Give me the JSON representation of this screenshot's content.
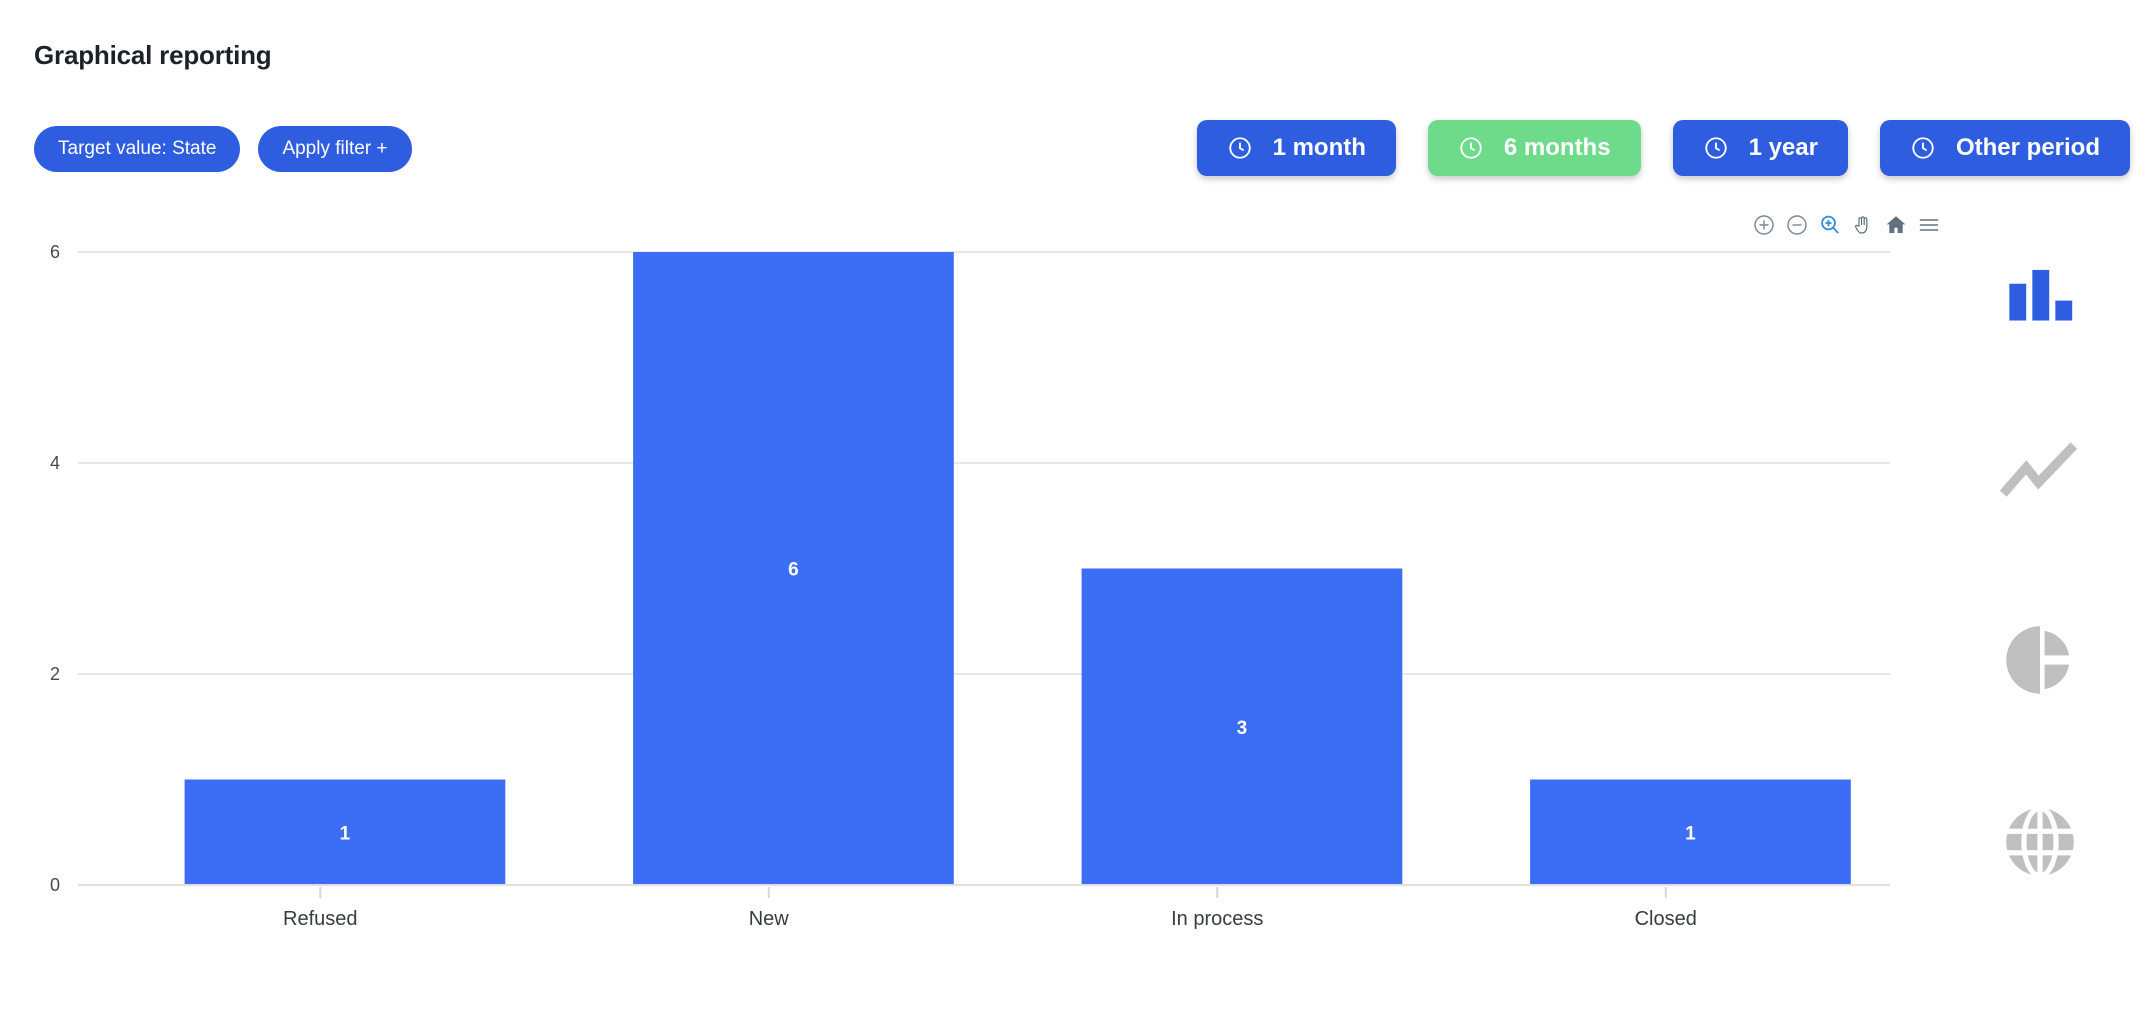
{
  "header": {
    "title": "Graphical reporting"
  },
  "filters": [
    {
      "label": "Target value: State",
      "name": "target-value-filter"
    },
    {
      "label": "Apply filter +",
      "name": "apply-filter-button"
    }
  ],
  "periods": [
    {
      "label": "1 month",
      "name": "period-1-month",
      "active": false,
      "icon": "clock-icon"
    },
    {
      "label": "6 months",
      "name": "period-6-months",
      "active": true,
      "icon": "clock-icon"
    },
    {
      "label": "1 year",
      "name": "period-1-year",
      "active": false,
      "icon": "clock-icon"
    },
    {
      "label": "Other period",
      "name": "period-other",
      "active": false,
      "icon": "clock-icon"
    }
  ],
  "chart_toolbar": [
    {
      "name": "zoom-in-icon",
      "title": "Zoom In"
    },
    {
      "name": "zoom-out-icon",
      "title": "Zoom Out"
    },
    {
      "name": "selection-zoom-icon",
      "title": "Selection Zoom",
      "active": true
    },
    {
      "name": "panning-icon",
      "title": "Panning"
    },
    {
      "name": "reset-home-icon",
      "title": "Reset Zoom"
    },
    {
      "name": "menu-icon",
      "title": "Menu"
    }
  ],
  "chart_type_rail": [
    {
      "name": "bar-chart-icon",
      "label": "Bar chart",
      "active": true
    },
    {
      "name": "line-chart-icon",
      "label": "Line chart",
      "active": false
    },
    {
      "name": "pie-chart-icon",
      "label": "Pie chart",
      "active": false
    },
    {
      "name": "globe-map-icon",
      "label": "Map view",
      "active": false
    }
  ],
  "colors": {
    "accent_blue": "#2f5de0",
    "bar_blue": "#3b6ef5",
    "active_green": "#6ddb8a",
    "toolbar_gray": "#7a8694",
    "toolbar_active": "#2f8ae0",
    "rail_gray": "#bfbfbf",
    "grid": "#e8e8e8",
    "axis_text": "#4a4a4a"
  },
  "chart_data": {
    "type": "bar",
    "title": "",
    "xlabel": "",
    "ylabel": "",
    "categories": [
      "Refused",
      "New",
      "In process",
      "Closed"
    ],
    "values": [
      1,
      6,
      3,
      1
    ],
    "series": [
      {
        "name": "State",
        "values": [
          1,
          6,
          3,
          1
        ]
      }
    ],
    "ylim": [
      0,
      6
    ],
    "yticks": [
      0,
      2,
      4,
      6
    ],
    "ytick_labels": [
      "0",
      "2",
      "4",
      "6"
    ],
    "data_labels": [
      "1",
      "6",
      "3",
      "1"
    ],
    "grid": true,
    "legend": "none",
    "bar_color": "#3b6ef5",
    "data_label_color": "#ffffff"
  }
}
